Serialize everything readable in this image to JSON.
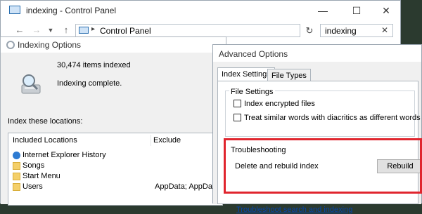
{
  "control_panel": {
    "window_title": "indexing - Control Panel",
    "address": "Control Panel",
    "search_value": "indexing"
  },
  "indexing_options": {
    "title": "Indexing Options",
    "items_indexed": "30,474 items indexed",
    "status": "Indexing complete.",
    "locations_label": "Index these locations:",
    "columns": {
      "included": "Included Locations",
      "exclude": "Exclude"
    },
    "locations": [
      {
        "icon": "internet-explorer-icon",
        "label": "Internet Explorer History",
        "exclude": ""
      },
      {
        "icon": "folder-icon",
        "label": "Songs",
        "exclude": ""
      },
      {
        "icon": "folder-icon",
        "label": "Start Menu",
        "exclude": ""
      },
      {
        "icon": "folder-icon",
        "label": "Users",
        "exclude": "AppData; AppData"
      }
    ]
  },
  "advanced_options": {
    "title": "Advanced Options",
    "tabs": [
      "Index Settings",
      "File Types"
    ],
    "active_tab": "Index Settings",
    "file_settings_label": "File Settings",
    "checkboxes": [
      {
        "label": "Index encrypted files",
        "checked": false
      },
      {
        "label": "Treat similar words with diacritics as different words",
        "checked": false
      }
    ],
    "troubleshooting_label": "Troubleshooting",
    "rebuild_label": "Delete and rebuild index",
    "rebuild_button": "Rebuild",
    "troubleshoot_link": "Troubleshoot search and indexing"
  },
  "colors": {
    "highlight": "#e0252e",
    "link": "#0645ad",
    "dialog_bg": "#f0f0f0"
  }
}
